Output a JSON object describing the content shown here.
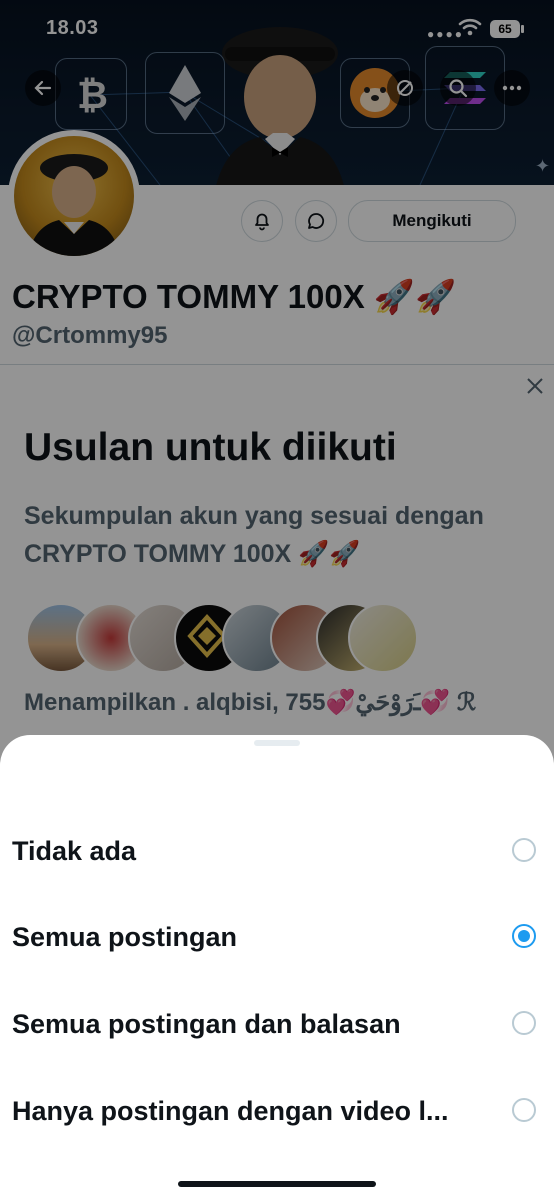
{
  "status_bar": {
    "time": "18.03",
    "battery": "65"
  },
  "banner": {
    "coins": [
      "bitcoin-icon",
      "ethereum-icon",
      "shiba-inu-icon",
      "solana-icon"
    ]
  },
  "profile": {
    "name": "CRYPTO TOMMY 100X 🚀🚀",
    "handle": "@Crtommy95",
    "follow_label": "Mengikuti"
  },
  "suggestions": {
    "title": "Usulan untuk diikuti",
    "subtitle": "Sekumpulan akun yang sesuai dengan CRYPTO TOMMY 100X 🚀🚀",
    "showing": "Menampilkan . alqbisi, 755💞ﹷرَوْحَيْ💞 ℛ"
  },
  "sheet": {
    "options": [
      {
        "label": "Tidak ada",
        "selected": false
      },
      {
        "label": "Semua postingan",
        "selected": true
      },
      {
        "label": "Semua postingan dan balasan",
        "selected": false
      },
      {
        "label": "Hanya postingan dengan video l...",
        "selected": false
      }
    ]
  },
  "colors": {
    "accent": "#1d9bf0",
    "text": "#0f1419",
    "secondary": "#536471"
  }
}
